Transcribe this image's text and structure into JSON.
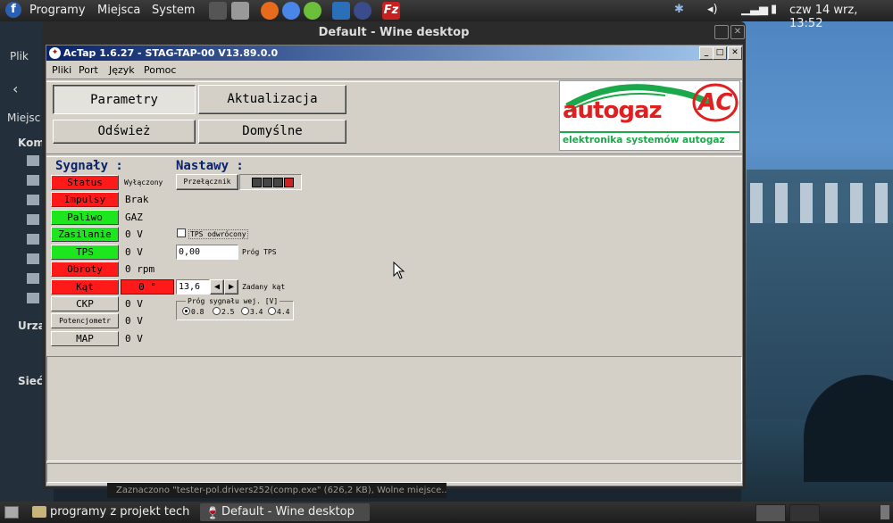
{
  "top_panel": {
    "menu": [
      "Programy",
      "Miejsca",
      "System"
    ],
    "clock": "czw 14 wrz, 13:52"
  },
  "wine_window": {
    "title": "Default - Wine desktop"
  },
  "left_sidebar": {
    "items": [
      "Plik",
      "Miejsc",
      "Kom",
      "Urzą",
      "Sieć"
    ]
  },
  "app": {
    "title": "AcTap 1.6.27 - STAG-TAP-00 V13.89.0.0",
    "menu": [
      "Pliki",
      "Port",
      "Język",
      "Pomoc"
    ],
    "buttons": {
      "parametry": "Parametry",
      "aktualizacja": "Aktualizacja",
      "odswiez": "Odśwież",
      "domyslne": "Domyślne"
    },
    "logo": {
      "brand": "autogaz",
      "mark": "AC",
      "tagline": "elektronika systemów autogaz"
    },
    "sygnaly_label": "Sygnały :",
    "nastawy_label": "Nastawy :",
    "signals": [
      {
        "name": "Status",
        "value": "Wyłączony",
        "color": "red"
      },
      {
        "name": "Impulsy",
        "value": "Brak",
        "color": "red"
      },
      {
        "name": "Paliwo",
        "value": "GAZ",
        "color": "green"
      },
      {
        "name": "Zasilanie",
        "value": "0 V",
        "color": "green"
      },
      {
        "name": "TPS",
        "value": "0 V",
        "color": "green"
      },
      {
        "name": "Obroty",
        "value": "0 rpm",
        "color": "red"
      },
      {
        "name": "Kąt",
        "value": "0 °",
        "color": "red"
      },
      {
        "name": "CKP",
        "value": "0 V",
        "color": "grey"
      },
      {
        "name": "Potencjometr",
        "value": "0 V",
        "color": "grey"
      },
      {
        "name": "MAP",
        "value": "0 V",
        "color": "grey"
      }
    ],
    "settings": {
      "switch_label": "Przełącznik",
      "tps_inverted_label": "TPS odwrócony",
      "tps_threshold_value": "0,00",
      "tps_threshold_label": "Próg TPS",
      "angle_value": "13,6",
      "angle_label": "Zadany kąt",
      "signal_threshold_title": "Próg sygnału wej. [V]",
      "signal_threshold_options": [
        "0.8",
        "2.5",
        "3.4",
        "4.4"
      ]
    }
  },
  "taskbar": {
    "tasks": [
      "programy z projekt tech",
      "Default - Wine desktop"
    ],
    "notification": "Zaznaczono \"tester-pol.drivers252(comp.exe\" (626,2 KB), Wolne miejsce..."
  },
  "colors": {
    "signal_red": "#ff1a1a",
    "signal_green": "#1ee61e",
    "titlebar": "#0a246a",
    "logo_red": "#e02020",
    "logo_green": "#1aa84a"
  }
}
